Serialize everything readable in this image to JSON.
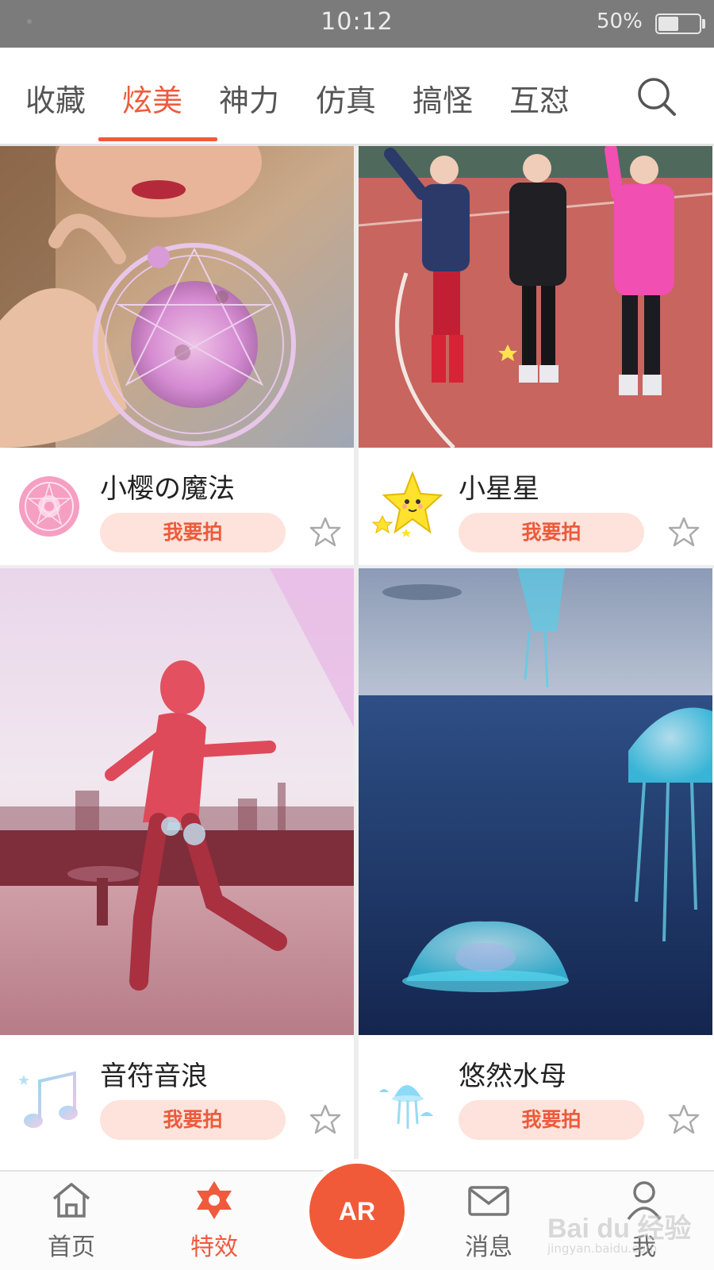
{
  "status_bar": {
    "time": "10:12",
    "battery_percent": "50%",
    "battery_level": 0.5
  },
  "tabs": {
    "items": [
      {
        "label": "收藏"
      },
      {
        "label": "炫美"
      },
      {
        "label": "神力"
      },
      {
        "label": "仿真"
      },
      {
        "label": "搞怪"
      },
      {
        "label": "互怼"
      }
    ],
    "active": "炫美",
    "search_icon": "search-icon"
  },
  "cards": [
    {
      "title": "小樱の魔法",
      "button": "我要拍",
      "icon": "magic-circle-icon",
      "thumbnail": "girl-with-pink-magic-circle"
    },
    {
      "title": "小星星",
      "button": "我要拍",
      "icon": "smiling-star-icon",
      "thumbnail": "three-kids-on-running-track"
    },
    {
      "title": "音符音浪",
      "button": "我要拍",
      "icon": "music-note-icon",
      "thumbnail": "dancer-silhouette-rooftop"
    },
    {
      "title": "悠然水母",
      "button": "我要拍",
      "icon": "jellyfish-icon",
      "thumbnail": "jellyfish-over-sea"
    }
  ],
  "bottom_nav": {
    "items": [
      {
        "label": "首页",
        "icon": "home-icon"
      },
      {
        "label": "特效",
        "icon": "star-of-david-icon"
      },
      {
        "label": "消息",
        "icon": "mail-icon"
      },
      {
        "label": "我",
        "icon": "person-icon"
      }
    ],
    "active": "特效",
    "ar_label": "AR"
  },
  "watermark": {
    "text": "Bai du 经验",
    "sub": "jingyan.baidu.com"
  },
  "colors": {
    "accent": "#f05a3c",
    "button_bg": "#fde3dc",
    "status_bar": "#7c7b7c"
  }
}
